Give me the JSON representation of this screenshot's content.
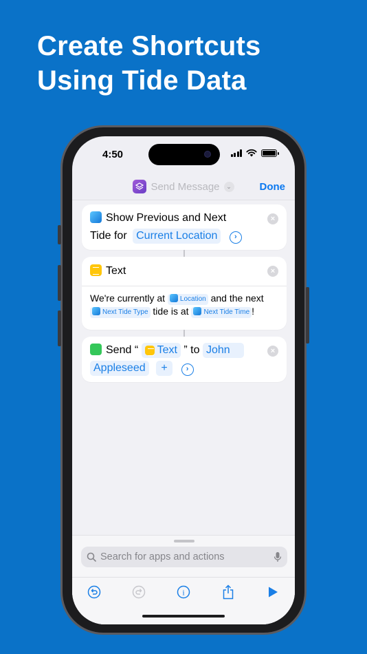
{
  "headline": {
    "line1": "Create Shortcuts",
    "line2": "Using Tide Data"
  },
  "status_bar": {
    "time": "4:50"
  },
  "nav": {
    "title": "Send Message",
    "done_label": "Done"
  },
  "actions": [
    {
      "title": "Show Previous and Next",
      "title2": "Tide for",
      "token": "Current Location"
    },
    {
      "title": "Text",
      "body": {
        "part1": "We're currently at",
        "token1": "Location",
        "part2": "and the next",
        "token2": "Next Tide Type",
        "part3": "tide is at",
        "token3": "Next Tide Time",
        "part4": "!"
      }
    },
    {
      "send_label": "Send “",
      "token_text": "Text",
      "to_label": "” to",
      "recipient": "John",
      "recipient2": "Appleseed",
      "plus": "+"
    }
  ],
  "search": {
    "placeholder": "Search for apps and actions"
  },
  "toolbar": {
    "info": "i"
  },
  "colors": {
    "background": "#0a72c8",
    "accent": "#1a7fe6",
    "shortcut_icon": "#7a4bd0",
    "text_icon": "#ffc60a",
    "messages_icon": "#34c759"
  },
  "icons": [
    "shortcuts-app-icon",
    "tide-icon",
    "text-icon",
    "messages-icon",
    "search-icon",
    "microphone-icon",
    "undo-icon",
    "redo-icon",
    "info-icon",
    "share-icon",
    "play-icon"
  ]
}
